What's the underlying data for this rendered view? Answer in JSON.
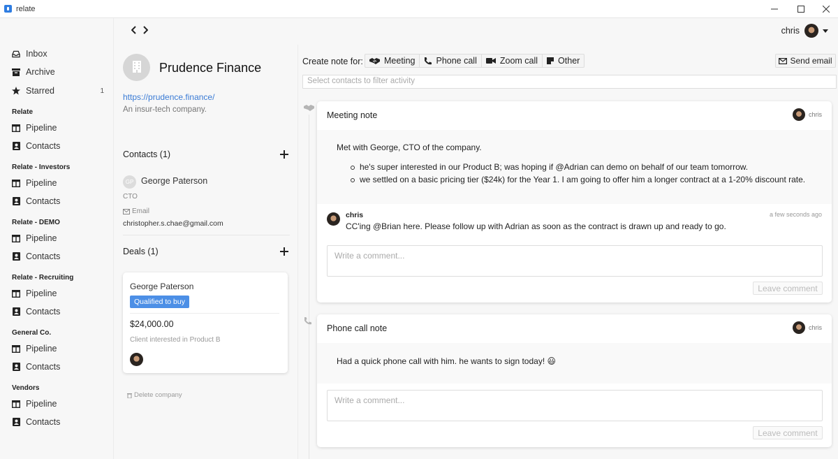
{
  "window": {
    "title": "relate"
  },
  "sidebar": {
    "top_items": [
      {
        "label": "Inbox",
        "icon": "inbox-icon"
      },
      {
        "label": "Archive",
        "icon": "archive-icon"
      },
      {
        "label": "Starred",
        "icon": "star-icon",
        "count": "1"
      }
    ],
    "groups": [
      {
        "heading": "Relate",
        "items": [
          "Pipeline",
          "Contacts"
        ]
      },
      {
        "heading": "Relate - Investors",
        "items": [
          "Pipeline",
          "Contacts"
        ]
      },
      {
        "heading": "Relate - DEMO",
        "items": [
          "Pipeline",
          "Contacts"
        ]
      },
      {
        "heading": "Relate - Recruiting",
        "items": [
          "Pipeline",
          "Contacts"
        ]
      },
      {
        "heading": "General Co.",
        "items": [
          "Pipeline",
          "Contacts"
        ]
      },
      {
        "heading": "Vendors",
        "items": [
          "Pipeline",
          "Contacts"
        ]
      }
    ]
  },
  "nav": {
    "back": "‹",
    "forward": "›"
  },
  "user": {
    "name": "chris"
  },
  "company": {
    "name": "Prudence Finance",
    "url": "https://prudence.finance/",
    "description": "An insur-tech company.",
    "contacts_heading": "Contacts (1)",
    "contact": {
      "initials": "GP",
      "name": "George Paterson",
      "title": "CTO",
      "email_label": "Email",
      "email": "christopher.s.chae@gmail.com"
    },
    "deals_heading": "Deals (1)",
    "deal": {
      "name": "George Paterson",
      "stage": "Qualified to buy",
      "amount": "$24,000.00",
      "note": "Client interested in Product B"
    },
    "delete_label": "Delete company"
  },
  "activity": {
    "create_label": "Create note for:",
    "note_types": [
      {
        "label": "Meeting",
        "icon": "handshake-icon"
      },
      {
        "label": "Phone call",
        "icon": "phone-icon"
      },
      {
        "label": "Zoom call",
        "icon": "video-icon"
      },
      {
        "label": "Other",
        "icon": "note-icon"
      }
    ],
    "send_email": "Send email",
    "filter_placeholder": "Select contacts to filter activity",
    "notes": [
      {
        "title": "Meeting note",
        "author": "chris",
        "text": "Met with George, CTO of the company.",
        "bullets": [
          "he's super interested in our Product B; was hoping if @Adrian can demo on behalf of our team tomorrow.",
          "we settled on a basic pricing tier ($24k) for the Year 1. I am going to offer him a longer contract at a 1-20% discount rate."
        ],
        "comment": {
          "author": "chris",
          "time": "a few seconds ago",
          "text": "CC'ing @Brian here. Please follow up with Adrian as soon as the contract is drawn up and ready to go."
        },
        "comment_placeholder": "Write a comment...",
        "comment_button": "Leave comment"
      },
      {
        "title": "Phone call note",
        "author": "chris",
        "text": "Had a quick phone call with him. he wants to sign today! 😃",
        "comment_placeholder": "Write a comment...",
        "comment_button": "Leave comment"
      }
    ]
  }
}
